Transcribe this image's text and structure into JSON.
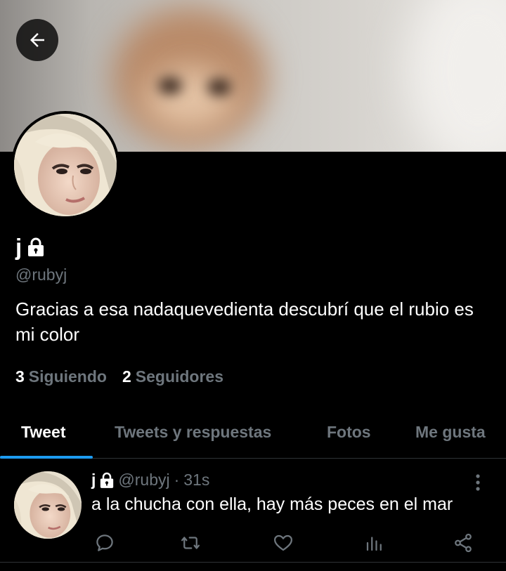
{
  "profile": {
    "display_name": "j",
    "handle": "@rubyj",
    "bio": "Gracias a esa nadaquevedienta descubrí que el rubio es mi color",
    "following_count": "3",
    "following_label": "Siguiendo",
    "followers_count": "2",
    "followers_label": "Seguidores"
  },
  "tabs": [
    {
      "label": "Tweet",
      "active": true
    },
    {
      "label": "Tweets y respuestas",
      "active": false
    },
    {
      "label": "Fotos",
      "active": false
    },
    {
      "label": "Me gusta",
      "active": false
    }
  ],
  "tweet": {
    "name": "j",
    "handle": "@rubyj",
    "separator": "·",
    "time": "31s",
    "text": "a la chucha con ella, hay más peces en el mar"
  },
  "icons": {
    "back": "arrow-left-icon",
    "lock": "lock-icon",
    "more": "more-vertical-icon",
    "reply": "reply-icon",
    "retweet": "retweet-icon",
    "like": "heart-icon",
    "analytics": "analytics-icon",
    "share": "share-icon"
  },
  "colors": {
    "background": "#000000",
    "accent": "#1d9bf0",
    "secondary_text": "#6e767d",
    "divider": "#2f3336"
  }
}
